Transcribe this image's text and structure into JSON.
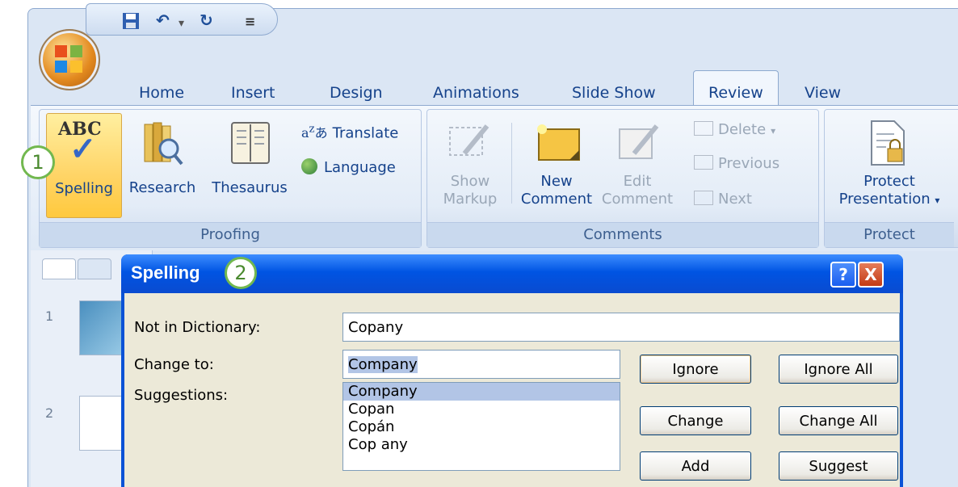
{
  "quick_access": {
    "save_icon": "save-icon",
    "undo_icon": "undo-icon",
    "redo_icon": "redo-icon",
    "customize_icon": "customize-qat-icon"
  },
  "tabs": [
    "Home",
    "Insert",
    "Design",
    "Animations",
    "Slide Show",
    "Review",
    "View"
  ],
  "active_tab": "Review",
  "ribbon": {
    "proofing": {
      "label": "Proofing",
      "spelling": "Spelling",
      "research": "Research",
      "thesaurus": "Thesaurus",
      "translate": "Translate",
      "language": "Language"
    },
    "comments": {
      "label": "Comments",
      "show_markup": [
        "Show",
        "Markup"
      ],
      "new_comment": [
        "New",
        "Comment"
      ],
      "edit_comment": [
        "Edit",
        "Comment"
      ],
      "delete": "Delete",
      "previous": "Previous",
      "next": "Next"
    },
    "protect": {
      "label": "Protect",
      "protect_presentation": [
        "Protect",
        "Presentation"
      ]
    }
  },
  "callouts": [
    "1",
    "2"
  ],
  "slides": [
    "1",
    "2"
  ],
  "dialog": {
    "title": "Spelling",
    "not_in_dictionary_label": "Not in Dictionary:",
    "not_in_dictionary_value": "Copany",
    "change_to_label": "Change to:",
    "change_to_value": "Company",
    "suggestions_label": "Suggestions:",
    "suggestions": [
      "Company",
      "Copan",
      "Copán",
      "Cop any"
    ],
    "buttons": {
      "ignore": "Ignore",
      "ignore_all": "Ignore All",
      "change": "Change",
      "change_all": "Change All",
      "add": "Add",
      "suggest": "Suggest"
    },
    "help": "?",
    "close": "X"
  }
}
